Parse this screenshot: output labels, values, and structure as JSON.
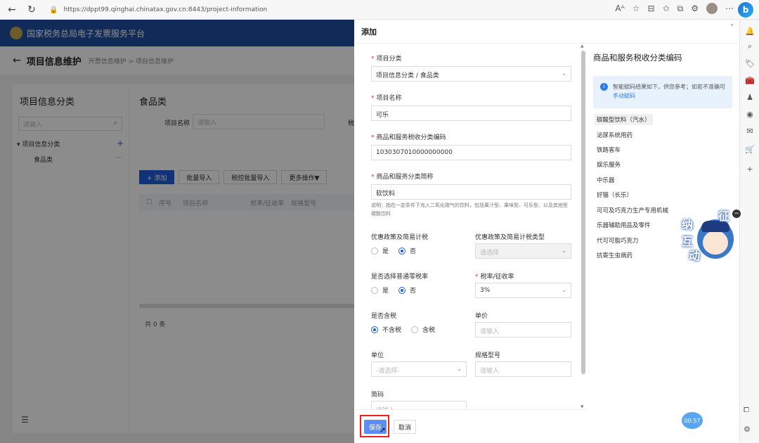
{
  "browser": {
    "url": "https://dppt99.qinghai.chinatax.gov.cn:8443/project-information",
    "copilot_glyph": "b"
  },
  "app": {
    "title": "国家税务总局电子发票服务平台",
    "page_title": "项目信息维护",
    "breadcrumb": "开票信息维护 > 项目信息维护",
    "left_panel": {
      "title": "项目信息分类",
      "search_placeholder": "请输入",
      "tree_root": "项目信息分类",
      "tree_child": "食品类"
    },
    "main_panel": {
      "title": "食品类",
      "name_label": "项目名称",
      "name_placeholder": "请输入",
      "rate_label": "税",
      "buttons": {
        "add": "+ 添加",
        "batch_import": "批量导入",
        "tax_batch_import": "税控批量导入",
        "more": "更多操作▼"
      },
      "columns": [
        "序号",
        "项目名称",
        "税率/征收率",
        "规格型号"
      ],
      "total": "共 0 条"
    }
  },
  "drawer": {
    "title": "添加",
    "fields": {
      "category": {
        "label": "项目分类",
        "value": "项目信息分类 / 食品类"
      },
      "name": {
        "label": "项目名称",
        "value": "可乐"
      },
      "tax_code": {
        "label": "商品和服务税收分类编码",
        "value": "1030307010000000000"
      },
      "short_name": {
        "label": "商品和服务分类简称",
        "value": "软饮料"
      },
      "note": "说明：指在一定条件下充入二氧化碳气的饮料，包括果汁型、果味型、可乐型、以及其他型碳酸饮料",
      "preferential": {
        "label": "优惠政策及简易计税",
        "yes": "是",
        "no": "否"
      },
      "preferential_type": {
        "label": "优惠政策及简易计税类型",
        "placeholder": "请选择"
      },
      "zero_rate": {
        "label": "是否选择普通零税率",
        "yes": "是",
        "no": "否"
      },
      "rate": {
        "label": "税率/征收率",
        "value": "3%"
      },
      "tax_included": {
        "label": "是否含税",
        "excl": "不含税",
        "incl": "含税"
      },
      "unit_price": {
        "label": "单价",
        "placeholder": "请输入"
      },
      "unit": {
        "label": "单位",
        "placeholder": "-请选择-"
      },
      "spec": {
        "label": "规格型号",
        "placeholder": "请输入"
      },
      "short_code": {
        "label": "简码",
        "placeholder": "请输入"
      }
    },
    "footer": {
      "save": "保存",
      "cancel": "取消"
    }
  },
  "code_panel": {
    "title": "商品和服务税收分类编码",
    "tip": "智能赋码结果如下，供您参考；如若不准确可",
    "tip_link": "手动赋码",
    "items": [
      "碳酸型饮料（汽水）",
      "泌尿系统用药",
      "铁路客车",
      "娱乐服务",
      "中乐器",
      "好猫（长乐）",
      "可可及巧克力生产专用机械",
      "乐器辅助用品及零件",
      "代可可脂巧克力",
      "抗寄生虫病药"
    ]
  },
  "mascot": {
    "chars": [
      "征",
      "纳",
      "互",
      "动"
    ]
  },
  "timer": "00:57"
}
